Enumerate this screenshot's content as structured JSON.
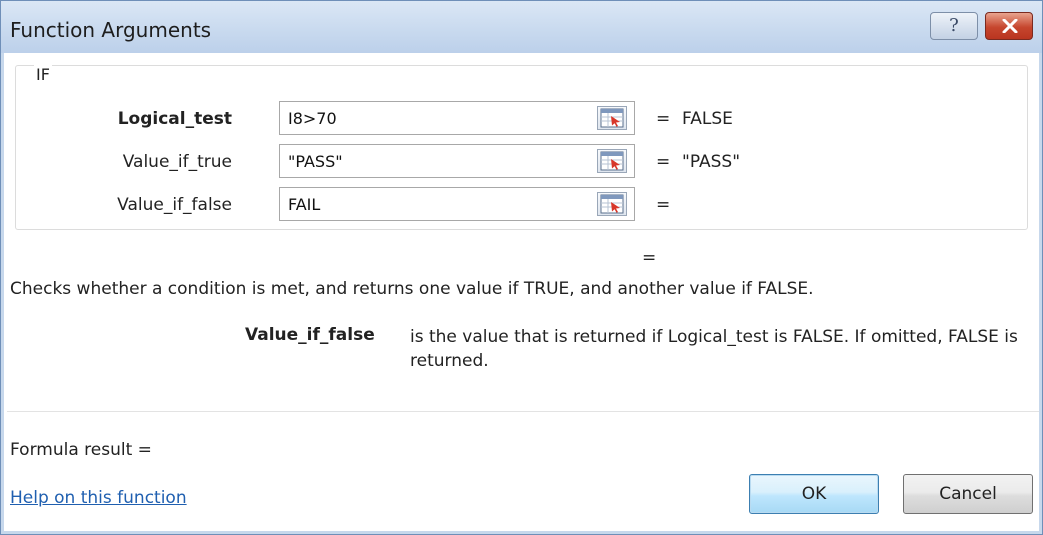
{
  "window": {
    "title": "Function Arguments",
    "help_glyph": "?",
    "close_icon": "close-icon"
  },
  "function": {
    "name": "IF",
    "arguments": [
      {
        "label": "Logical_test",
        "bold": true,
        "value": "I8>70",
        "result_sign": "=",
        "result": "FALSE"
      },
      {
        "label": "Value_if_true",
        "bold": false,
        "value": "\"PASS\"",
        "result_sign": "=",
        "result": "\"PASS\""
      },
      {
        "label": "Value_if_false",
        "bold": false,
        "value": "FAIL",
        "result_sign": "=",
        "result": ""
      }
    ],
    "overall_result_sign": "=",
    "description": "Checks whether a condition is met, and returns one value if TRUE, and another value if FALSE.",
    "active_argument": {
      "name": "Value_if_false",
      "description": "is the value that is returned if Logical_test is FALSE. If omitted, FALSE is returned."
    }
  },
  "footer": {
    "formula_result": "Formula result =",
    "help_link": "Help on this function",
    "ok_label": "OK",
    "cancel_label": "Cancel"
  }
}
